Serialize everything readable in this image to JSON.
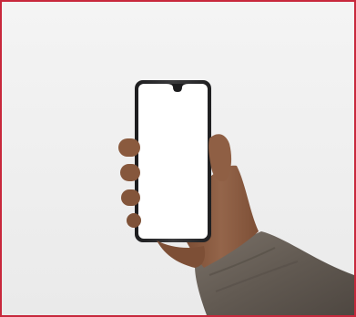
{
  "image": {
    "subject": "hand-holding-smartphone",
    "border_color": "#c8283c",
    "background_color": "#efefef",
    "phone_screen_color": "#ffffff",
    "phone_body_color": "#2a2a2c",
    "skin_color": "#8a5a3e",
    "sleeve_color": "#6b625a"
  }
}
